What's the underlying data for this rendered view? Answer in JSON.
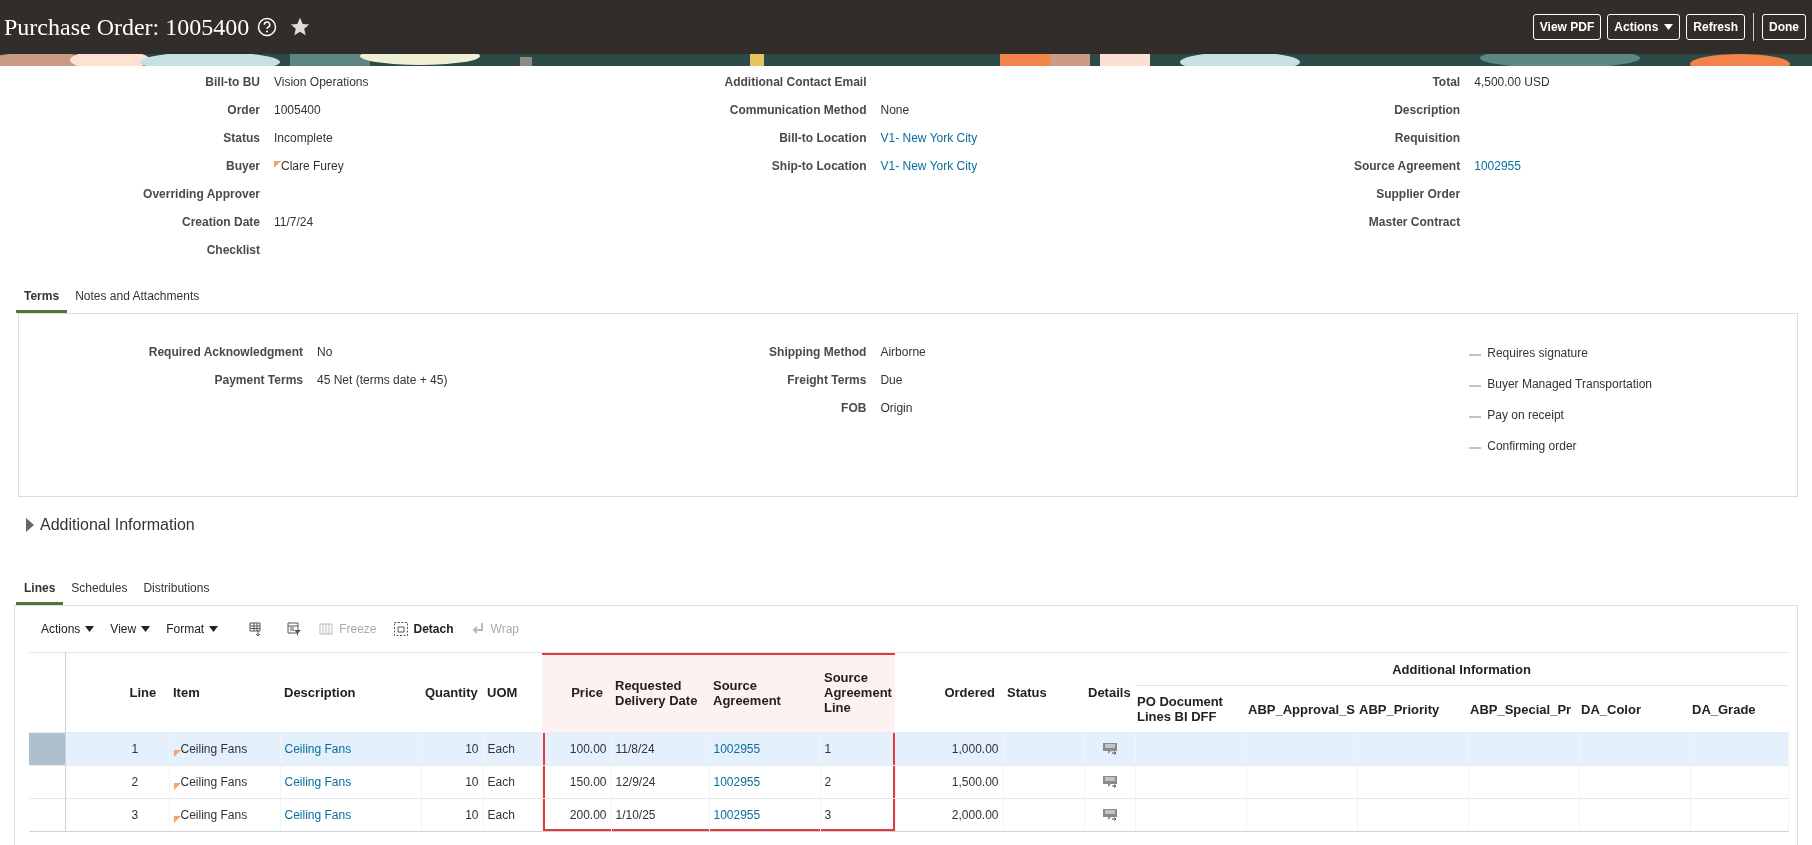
{
  "header": {
    "title": "Purchase Order: 1005400",
    "buttons": [
      {
        "label": "View PDF",
        "kind": "button"
      },
      {
        "label": "Actions",
        "kind": "menu"
      },
      {
        "label": "Refresh",
        "kind": "button"
      },
      {
        "label": "Done",
        "kind": "button"
      }
    ]
  },
  "summary": {
    "columns": [
      [
        {
          "label": "Bill-to BU",
          "value": "Vision Operations",
          "kind": "text"
        },
        {
          "label": "Order",
          "value": "1005400",
          "kind": "text"
        },
        {
          "label": "Status",
          "value": "Incomplete",
          "kind": "text"
        },
        {
          "label": "Buyer",
          "value": "Clare Furey",
          "kind": "person"
        },
        {
          "label": "Overriding Approver"
        },
        {
          "label": "Creation Date",
          "value": "11/7/24",
          "kind": "text"
        },
        {
          "label": "Checklist"
        }
      ],
      [
        {
          "label": "Additional Contact Email"
        },
        {
          "label": "Communication Method",
          "value": "None",
          "kind": "text"
        },
        {
          "label": "Bill-to Location",
          "value": "V1- New York City",
          "kind": "link"
        },
        {
          "label": "Ship-to Location",
          "value": "V1- New York City",
          "kind": "link"
        }
      ],
      [
        {
          "label": "Total",
          "value": "4,500.00 USD",
          "kind": "text"
        },
        {
          "label": "Description"
        },
        {
          "label": "Requisition"
        },
        {
          "label": "Source Agreement",
          "value": "1002955",
          "kind": "link"
        },
        {
          "label": "Supplier Order"
        },
        {
          "label": "Master Contract"
        }
      ]
    ]
  },
  "terms_tabs": [
    {
      "label": "Terms",
      "selected": true
    },
    {
      "label": "Notes and Attachments",
      "selected": false
    }
  ],
  "terms": {
    "columns": [
      [
        {
          "label": "Required Acknowledgment",
          "value": "No",
          "kind": "text"
        },
        {
          "label": "Payment Terms",
          "value": "45 Net (terms date + 45)",
          "kind": "text"
        }
      ],
      [
        {
          "label": "Shipping Method",
          "value": "Airborne",
          "kind": "text"
        },
        {
          "label": "Freight Terms",
          "value": "Due",
          "kind": "text"
        },
        {
          "label": "FOB",
          "value": "Origin",
          "kind": "text"
        }
      ]
    ],
    "options": [
      {
        "label": "Requires signature",
        "checked": false
      },
      {
        "label": "Buyer Managed Transportation",
        "checked": false
      },
      {
        "label": "Pay on receipt",
        "checked": false
      },
      {
        "label": "Confirming order",
        "checked": false
      }
    ]
  },
  "additional_information": {
    "title": "Additional Information",
    "expanded": false
  },
  "lines_tabs": [
    {
      "label": "Lines",
      "selected": true
    },
    {
      "label": "Schedules",
      "selected": false
    },
    {
      "label": "Distributions",
      "selected": false
    }
  ],
  "toolbar": [
    {
      "kind": "menu",
      "label": "Actions"
    },
    {
      "kind": "menu",
      "label": "View"
    },
    {
      "kind": "menu",
      "label": "Format"
    },
    {
      "kind": "export"
    },
    {
      "kind": "query"
    },
    {
      "kind": "freeze",
      "label": "Freeze",
      "disabled": true
    },
    {
      "kind": "detach",
      "label": "Detach",
      "disabled": false
    },
    {
      "kind": "wrap",
      "label": "Wrap",
      "disabled": true
    }
  ],
  "table": {
    "columns": [
      {
        "label": "Line",
        "kind": "text",
        "highlighted": false
      },
      {
        "label": "Item",
        "kind": "item",
        "highlighted": false
      },
      {
        "label": "Description",
        "kind": "link",
        "highlighted": false
      },
      {
        "label": "Quantity",
        "kind": "number",
        "highlighted": false
      },
      {
        "label": "UOM",
        "kind": "text",
        "highlighted": false
      },
      {
        "label": "Price",
        "kind": "number",
        "highlighted": true
      },
      {
        "label": "Requested Delivery Date",
        "kind": "text",
        "highlighted": true
      },
      {
        "label": "Source Agreement",
        "kind": "link",
        "highlighted": true
      },
      {
        "label": "Source Agreement Line",
        "kind": "text",
        "highlighted": true
      },
      {
        "label": "Ordered",
        "kind": "number",
        "highlighted": false
      },
      {
        "label": "Status",
        "kind": "text",
        "highlighted": false
      },
      {
        "label": "Details",
        "kind": "details",
        "highlighted": false
      }
    ],
    "group": {
      "label": "Additional Information",
      "columns": [
        {
          "label": "PO Document Lines BI DFF"
        },
        {
          "label": "ABP_Approval_S"
        },
        {
          "label": "ABP_Priority"
        },
        {
          "label": "ABP_Special_Pr"
        },
        {
          "label": "DA_Color"
        },
        {
          "label": "DA_Grade"
        }
      ]
    },
    "rows": [
      {
        "selected": true,
        "cells": [
          "1",
          "Ceiling Fans",
          "Ceiling Fans",
          "10",
          "Each",
          "100.00",
          "11/8/24",
          "1002955",
          "1",
          "1,000.00"
        ]
      },
      {
        "selected": false,
        "cells": [
          "2",
          "Ceiling Fans",
          "Ceiling Fans",
          "10",
          "Each",
          "150.00",
          "12/9/24",
          "1002955",
          "2",
          "1,500.00"
        ]
      },
      {
        "selected": false,
        "cells": [
          "3",
          "Ceiling Fans",
          "Ceiling Fans",
          "10",
          "Each",
          "200.00",
          "1/10/25",
          "1002955",
          "3",
          "2,000.00"
        ]
      }
    ]
  }
}
